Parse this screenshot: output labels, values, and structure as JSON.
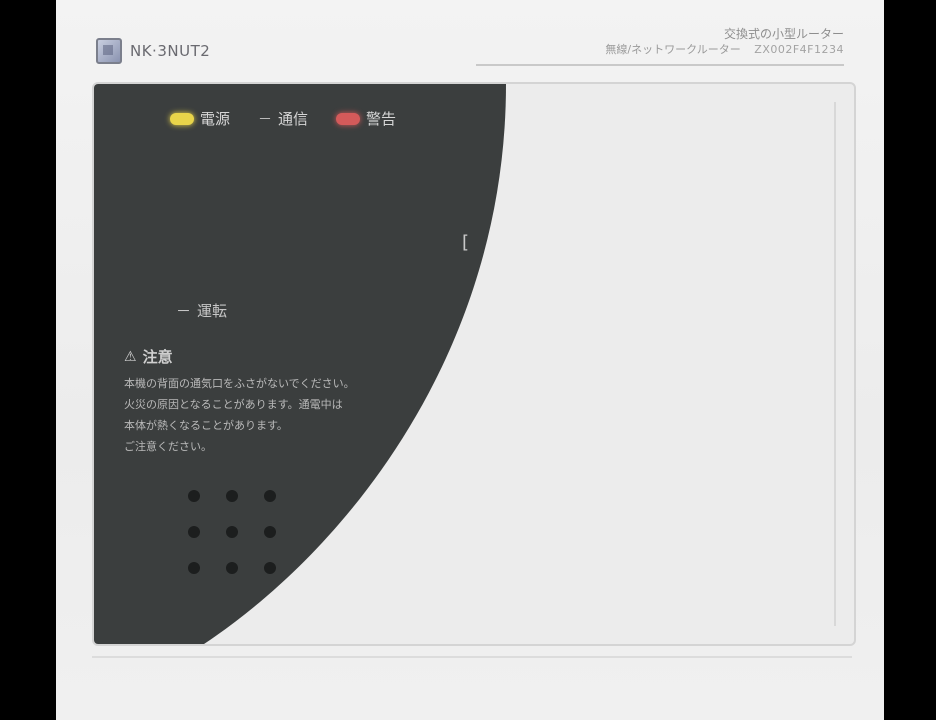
{
  "brand": {
    "name": "NK·3NUT2",
    "logo_icon": "brand-logo-icon"
  },
  "header": {
    "line1": "交換式の小型ルーター",
    "line2_desc": "無線/ネットワークルーター",
    "line2_model": "ZX002F4F1234"
  },
  "indicators": [
    {
      "label": "電源",
      "color": "#e8d44a",
      "state": "on"
    },
    {
      "label": "通信",
      "color": "",
      "state": "off"
    },
    {
      "label": "警告",
      "color": "#d45a5a",
      "state": "on"
    }
  ],
  "side_glyph": "[",
  "run_row": {
    "label": "運転",
    "mark": "－"
  },
  "warning": {
    "title": "注意",
    "icon": "warning-triangle-icon",
    "lines": [
      "本機の背面の通気口をふさがないでください。",
      "火災の原因となることがあります。通電中は",
      "本体が熱くなることがあります。",
      "ご注意ください。"
    ]
  },
  "grille": {
    "rows": 3,
    "cols": 3
  },
  "colors": {
    "panel_dark": "#3b3e3e",
    "background": "#ececec",
    "accent_yellow": "#e8d44a",
    "accent_red": "#d45a5a"
  }
}
